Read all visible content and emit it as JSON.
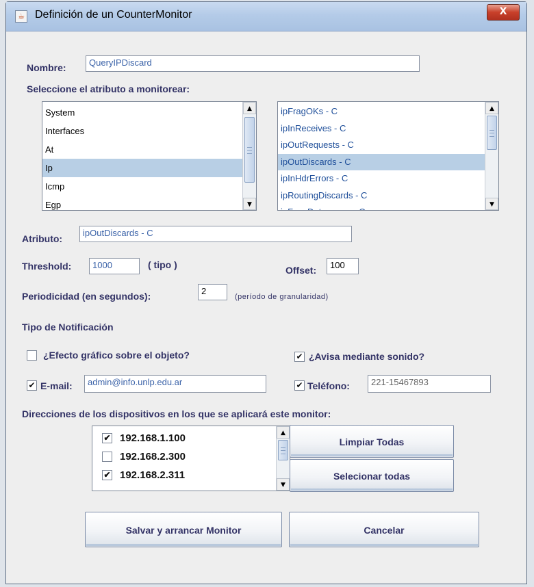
{
  "window": {
    "title": "Definición de un CounterMonitor",
    "close_label": "X"
  },
  "form": {
    "nombre_label": "Nombre:",
    "nombre_value": "QueryIPDiscard",
    "select_attr_label": "Seleccione el atributo a monitorear:",
    "groups": [
      "System",
      "Interfaces",
      "At",
      "Ip",
      "Icmp",
      "Egp"
    ],
    "groups_selected": "Ip",
    "attributes": [
      "ipFragOKs - C",
      "ipInReceives - C",
      "ipOutRequests - C",
      "ipOutDiscards - C",
      "ipInHdrErrors - C",
      "ipRoutingDiscards - C",
      "ipForwDatagrams - C"
    ],
    "attributes_selected": "ipOutDiscards - C",
    "atributo_label": "Atributo:",
    "atributo_value": "ipOutDiscards - C",
    "threshold_label": "Threshold:",
    "threshold_value": "1000",
    "tipo_label": "( tipo )",
    "offset_label": "Offset:",
    "offset_value": "100",
    "periodicidad_label": "Periodicidad (en segundos):",
    "periodicidad_value": "2",
    "granularidad_note": "(período de granularidad)",
    "tipo_notificacion_label": "Tipo de Notificación",
    "efecto_label": "¿Efecto gráfico sobre el objeto?",
    "efecto_checked": false,
    "sonido_label": "¿Avisa mediante sonido?",
    "sonido_checked": true,
    "email_label": "E-mail:",
    "email_checked": true,
    "email_value": "admin@info.unlp.edu.ar",
    "telefono_label": "Teléfono:",
    "telefono_checked": true,
    "telefono_value": "221-15467893",
    "direcciones_label": "Direcciones de los dispositivos en los que se aplicará este monitor:",
    "devices": [
      {
        "ip": "192.168.1.100",
        "checked": true
      },
      {
        "ip": "192.168.2.300",
        "checked": false
      },
      {
        "ip": "192.168.2.311",
        "checked": true
      }
    ]
  },
  "buttons": {
    "limpiar": "Limpiar Todas",
    "seleccionar": "Selecionar todas",
    "salvar": "Salvar y arrancar Monitor",
    "cancelar": "Cancelar"
  },
  "check_glyph": "✔"
}
